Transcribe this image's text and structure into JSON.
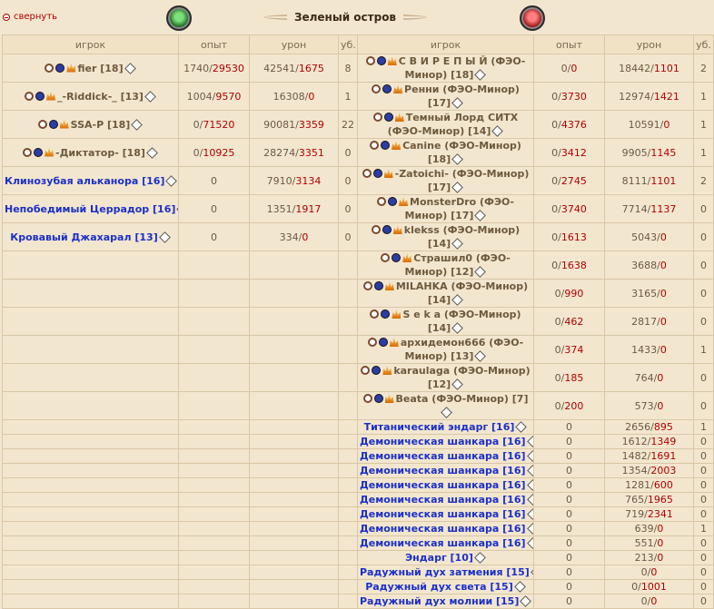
{
  "header": {
    "collapse_label": "свернуть",
    "title": "Зеленый остров",
    "green_emblem": "green-team-emblem",
    "red_emblem": "red-team-emblem"
  },
  "columns": {
    "player": "игрок",
    "exp": "опыт",
    "dmg": "урон",
    "kills": "уб."
  },
  "left": [
    {
      "name": "fier [18]",
      "type": "player",
      "exp": [
        "1740",
        "29530"
      ],
      "dmg": [
        "42541",
        "1675"
      ],
      "kills": "8"
    },
    {
      "name": "_-Riddick-_ [13]",
      "type": "player",
      "exp": [
        "1004",
        "9570"
      ],
      "dmg": [
        "16308",
        "0"
      ],
      "kills": "1"
    },
    {
      "name": "SSA-P [18]",
      "type": "player",
      "exp": [
        "0",
        "71520"
      ],
      "dmg": [
        "90081",
        "3359"
      ],
      "kills": "22"
    },
    {
      "name": "-Диктатор- [18]",
      "type": "player",
      "exp": [
        "0",
        "10925"
      ],
      "dmg": [
        "28274",
        "3351"
      ],
      "kills": "0"
    },
    {
      "name": "Клинозубая альканора [16]",
      "type": "bot",
      "exp": [
        "0"
      ],
      "dmg": [
        "7910",
        "3134"
      ],
      "kills": "0"
    },
    {
      "name": "Непобедимый Церрадор [16]",
      "type": "bot",
      "exp": [
        "0"
      ],
      "dmg": [
        "1351",
        "1917"
      ],
      "kills": "0"
    },
    {
      "name": "Кровавый Джахарал [13]",
      "type": "bot",
      "exp": [
        "0"
      ],
      "dmg": [
        "334",
        "0"
      ],
      "kills": "0"
    }
  ],
  "right": [
    {
      "name": "С В И Р Е П Ы Й (ФЭО-Минор) [18]",
      "type": "player",
      "exp": [
        "0",
        "0"
      ],
      "dmg": [
        "18442",
        "1101"
      ],
      "kills": "2"
    },
    {
      "name": "Ренни (ФЭО-Минор) [17]",
      "type": "player",
      "exp": [
        "0",
        "3730"
      ],
      "dmg": [
        "12974",
        "1421"
      ],
      "kills": "1"
    },
    {
      "name": "Темный Лорд СИТХ (ФЭО-Минор) [14]",
      "type": "player",
      "exp": [
        "0",
        "4376"
      ],
      "dmg": [
        "10591",
        "0"
      ],
      "kills": "1"
    },
    {
      "name": "Canine (ФЭО-Минор) [18]",
      "type": "player",
      "exp": [
        "0",
        "3412"
      ],
      "dmg": [
        "9905",
        "1145"
      ],
      "kills": "1"
    },
    {
      "name": "-Zatoichi- (ФЭО-Минор) [17]",
      "type": "player",
      "exp": [
        "0",
        "2745"
      ],
      "dmg": [
        "8111",
        "1101"
      ],
      "kills": "2"
    },
    {
      "name": "MonsterDro (ФЭО-Минор) [17]",
      "type": "player",
      "exp": [
        "0",
        "3740"
      ],
      "dmg": [
        "7714",
        "1137"
      ],
      "kills": "0"
    },
    {
      "name": "klekss (ФЭО-Минор) [14]",
      "type": "player",
      "exp": [
        "0",
        "1613"
      ],
      "dmg": [
        "5043",
        "0"
      ],
      "kills": "0"
    },
    {
      "name": "Страшил0 (ФЭО-Минор) [12]",
      "type": "player",
      "exp": [
        "0",
        "1638"
      ],
      "dmg": [
        "3688",
        "0"
      ],
      "kills": "0"
    },
    {
      "name": "MILAHKA (ФЭО-Минор) [14]",
      "type": "player",
      "exp": [
        "0",
        "990"
      ],
      "dmg": [
        "3165",
        "0"
      ],
      "kills": "0"
    },
    {
      "name": "S e k a (ФЭО-Минор) [14]",
      "type": "player",
      "exp": [
        "0",
        "462"
      ],
      "dmg": [
        "2817",
        "0"
      ],
      "kills": "0"
    },
    {
      "name": "архидемон666 (ФЭО-Минор) [13]",
      "type": "player",
      "exp": [
        "0",
        "374"
      ],
      "dmg": [
        "1433",
        "0"
      ],
      "kills": "1"
    },
    {
      "name": "karaulaga (ФЭО-Минор) [12]",
      "type": "player",
      "exp": [
        "0",
        "185"
      ],
      "dmg": [
        "764",
        "0"
      ],
      "kills": "0"
    },
    {
      "name": "Beata (ФЭО-Минор) [7]",
      "type": "player",
      "exp": [
        "0",
        "200"
      ],
      "dmg": [
        "573",
        "0"
      ],
      "kills": "0"
    },
    {
      "name": "Титанический эндарг [16]",
      "type": "bot",
      "exp": [
        "0"
      ],
      "dmg": [
        "2656",
        "895"
      ],
      "kills": "1"
    },
    {
      "name": "Демоническая шанкара [16]",
      "type": "bot",
      "exp": [
        "0"
      ],
      "dmg": [
        "1612",
        "1349"
      ],
      "kills": "0"
    },
    {
      "name": "Демоническая шанкара [16]",
      "type": "bot",
      "exp": [
        "0"
      ],
      "dmg": [
        "1482",
        "1691"
      ],
      "kills": "0"
    },
    {
      "name": "Демоническая шанкара [16]",
      "type": "bot",
      "exp": [
        "0"
      ],
      "dmg": [
        "1354",
        "2003"
      ],
      "kills": "0"
    },
    {
      "name": "Демоническая шанкара [16]",
      "type": "bot",
      "exp": [
        "0"
      ],
      "dmg": [
        "1281",
        "600"
      ],
      "kills": "0"
    },
    {
      "name": "Демоническая шанкара [16]",
      "type": "bot",
      "exp": [
        "0"
      ],
      "dmg": [
        "765",
        "1965"
      ],
      "kills": "0"
    },
    {
      "name": "Демоническая шанкара [16]",
      "type": "bot",
      "exp": [
        "0"
      ],
      "dmg": [
        "719",
        "2341"
      ],
      "kills": "0"
    },
    {
      "name": "Демоническая шанкара [16]",
      "type": "bot",
      "exp": [
        "0"
      ],
      "dmg": [
        "639",
        "0"
      ],
      "kills": "1"
    },
    {
      "name": "Демоническая шанкара [16]",
      "type": "bot",
      "exp": [
        "0"
      ],
      "dmg": [
        "551",
        "0"
      ],
      "kills": "0"
    },
    {
      "name": "Эндарг [10]",
      "type": "bot",
      "exp": [
        "0"
      ],
      "dmg": [
        "213",
        "0"
      ],
      "kills": "0"
    },
    {
      "name": "Радужный дух затмения [15]",
      "type": "bot",
      "exp": [
        "0"
      ],
      "dmg": [
        "0",
        "0"
      ],
      "kills": "0"
    },
    {
      "name": "Радужный дух света [15]",
      "type": "bot",
      "exp": [
        "0"
      ],
      "dmg": [
        "0",
        "1001"
      ],
      "kills": "0"
    },
    {
      "name": "Радужный дух молнии [15]",
      "type": "bot",
      "exp": [
        "0"
      ],
      "dmg": [
        "0",
        "0"
      ],
      "kills": "0"
    }
  ],
  "row_heights": [
    28,
    16,
    28,
    16,
    28,
    28,
    16,
    28,
    28,
    16,
    28,
    28,
    16,
    16,
    16,
    16,
    16,
    16,
    16,
    16,
    16,
    16,
    16,
    16,
    16,
    16
  ]
}
